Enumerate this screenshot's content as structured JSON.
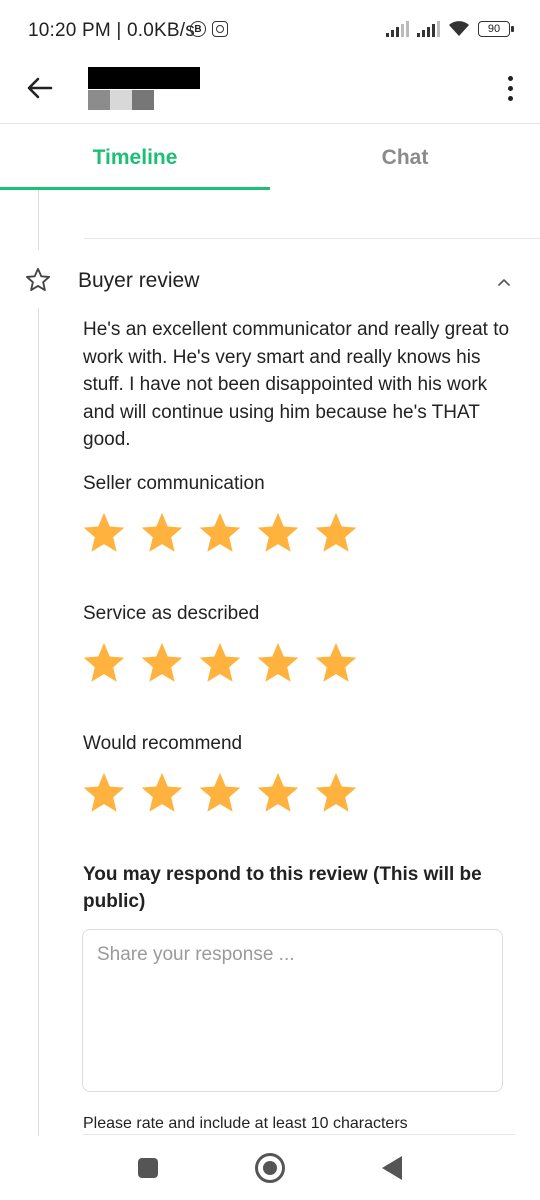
{
  "status_bar": {
    "time": "10:20 PM | 0.0KB/s",
    "battery": "90",
    "icons": [
      "b-circle-icon",
      "instagram-icon",
      "signal-icon",
      "signal-icon",
      "wifi-icon",
      "battery-icon"
    ]
  },
  "app_bar": {
    "back_icon": "arrow-left-icon",
    "menu_icon": "more-vert-icon"
  },
  "tabs": [
    {
      "label": "Timeline",
      "active": true
    },
    {
      "label": "Chat",
      "active": false
    }
  ],
  "review": {
    "title": "Buyer review",
    "icon": "star-outline-icon",
    "collapse_icon": "chevron-up-icon",
    "text": "He's an excellent communicator and really great to work with. He's very smart and really knows his stuff. I have not been disappointed with his work and will continue using him because he's THAT good.",
    "ratings": [
      {
        "label": "Seller communication",
        "stars": 5
      },
      {
        "label": "Service as described",
        "stars": 5
      },
      {
        "label": "Would recommend",
        "stars": 5
      }
    ]
  },
  "response": {
    "title": "You may respond to this review (This will be public)",
    "placeholder": "Share your response ...",
    "helper": "Please rate and include at least 10 characters"
  },
  "colors": {
    "accent": "#1dbf73",
    "star": "#ffb33e",
    "text": "#222222",
    "muted": "#8a8a8a"
  }
}
